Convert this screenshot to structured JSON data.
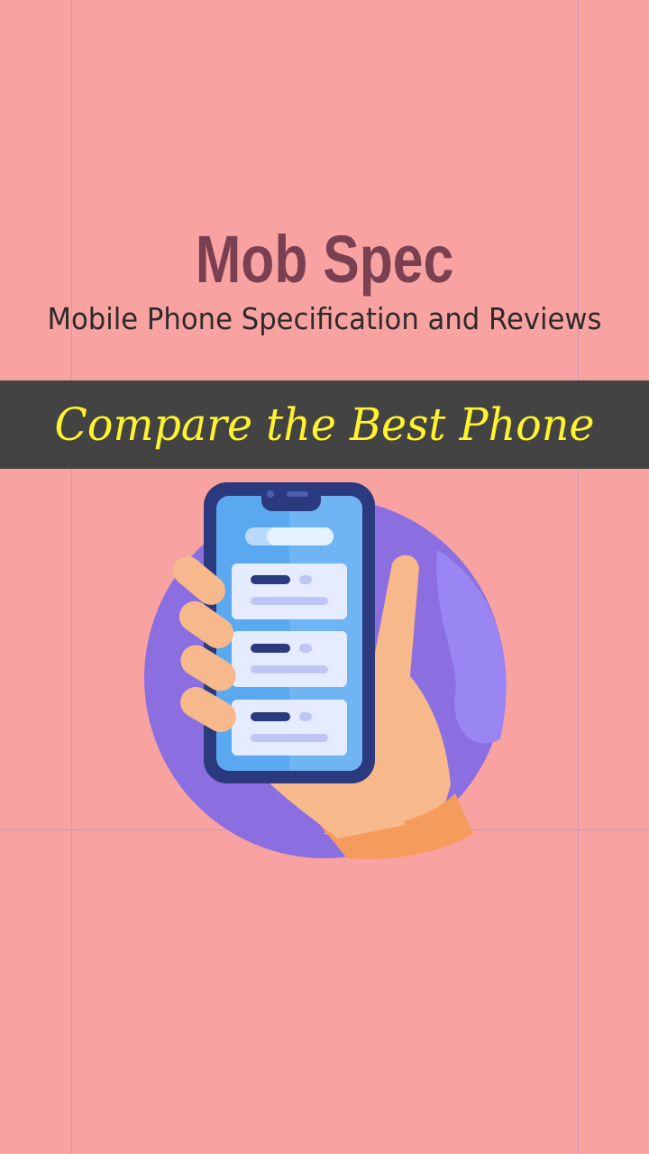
{
  "app": {
    "title": "Mob Spec",
    "subtitle": "Mobile Phone Specification and Reviews"
  },
  "banner": {
    "text": "Compare the Best Phone"
  },
  "illustration": {
    "icon": "hand-holding-phone-icon"
  },
  "colors": {
    "background": "#F8A3A1",
    "title": "#7A4052",
    "subtitle": "#2E2A2A",
    "banner_bg": "#434343",
    "banner_text": "#FFF22E",
    "circle": "#8B6FE0",
    "circle_light": "#9A86F2",
    "skin": "#F7B98B",
    "skin_dark": "#F59C5C",
    "phone_frame": "#2B3A7E",
    "screen_blue": "#5AA9F0",
    "card": "#E6ECFF"
  }
}
